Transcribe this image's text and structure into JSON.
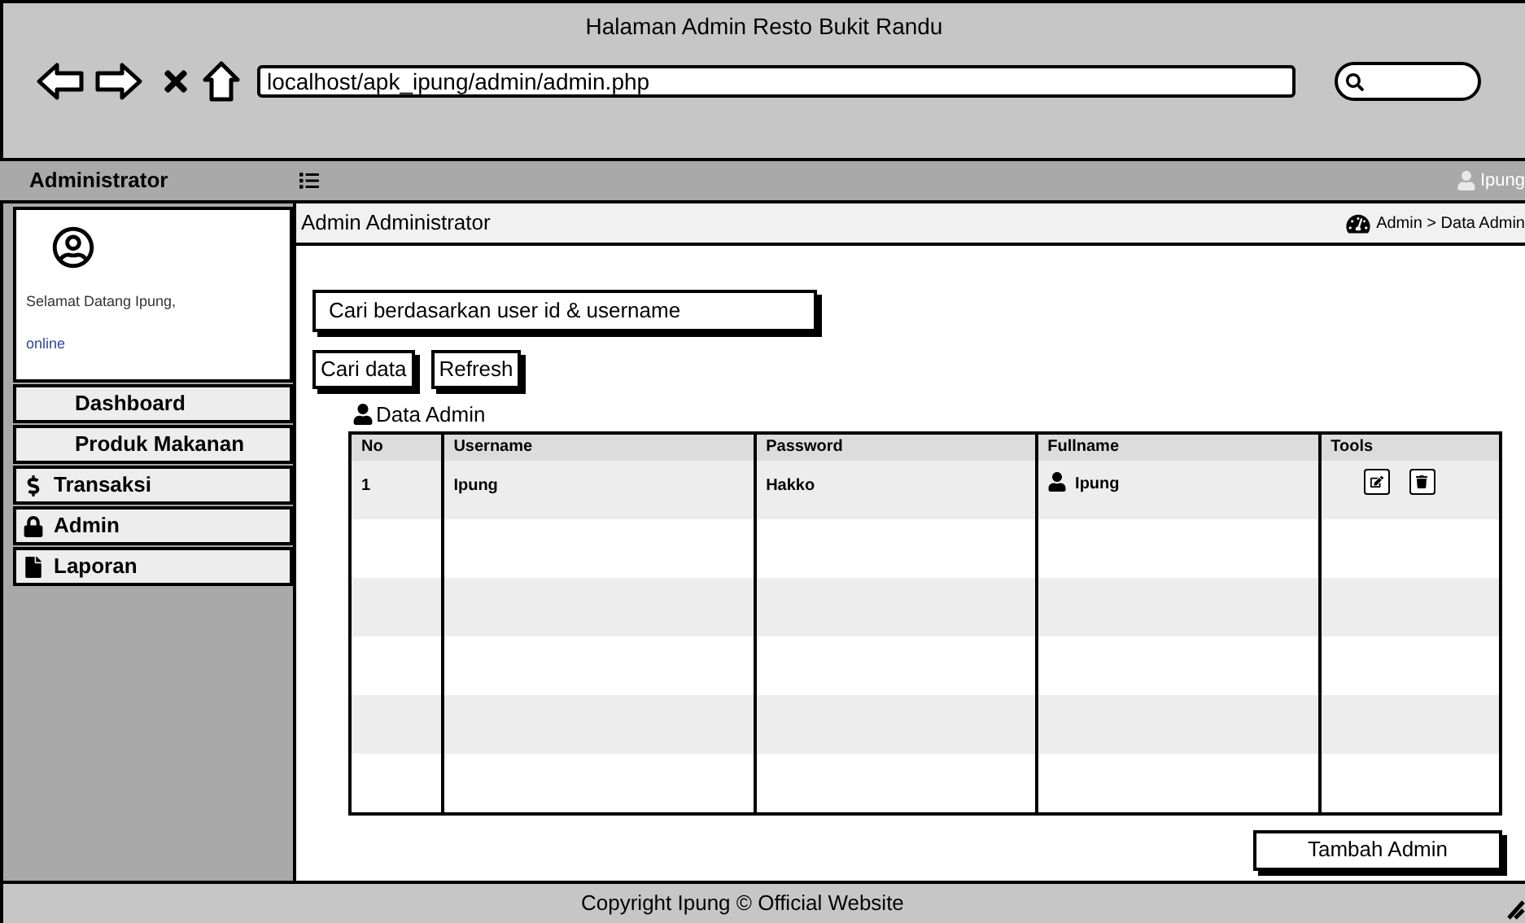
{
  "browser": {
    "title": "Halaman Admin Resto Bukit Randu",
    "url": "localhost/apk_ipung/admin/admin.php"
  },
  "topbar": {
    "brand": "Administrator",
    "user": "Ipung"
  },
  "sidebar": {
    "greeting": "Selamat Datang Ipung,",
    "status": "online",
    "menu": [
      {
        "label": "Dashboard"
      },
      {
        "label": "Produk Makanan"
      },
      {
        "label": "Transaksi"
      },
      {
        "label": "Admin"
      },
      {
        "label": "Laporan"
      }
    ]
  },
  "content": {
    "title": "Admin Administrator",
    "breadcrumb": "Admin > Data Admin",
    "search": {
      "value": "Cari berdasarkan user id & username"
    },
    "buttons": [
      "Cari data",
      "Refresh"
    ],
    "table_title": "Data Admin",
    "table": {
      "columns": [
        "No",
        "Username",
        "Password",
        "Fullname",
        "Tools"
      ],
      "rows": [
        {
          "no": "1",
          "username": "Ipung",
          "password": "Hakko",
          "fullname": "Ipung"
        }
      ]
    },
    "add_button": "Tambah Admin"
  },
  "footer": {
    "text": "Copyright Ipung © Official Website"
  }
}
